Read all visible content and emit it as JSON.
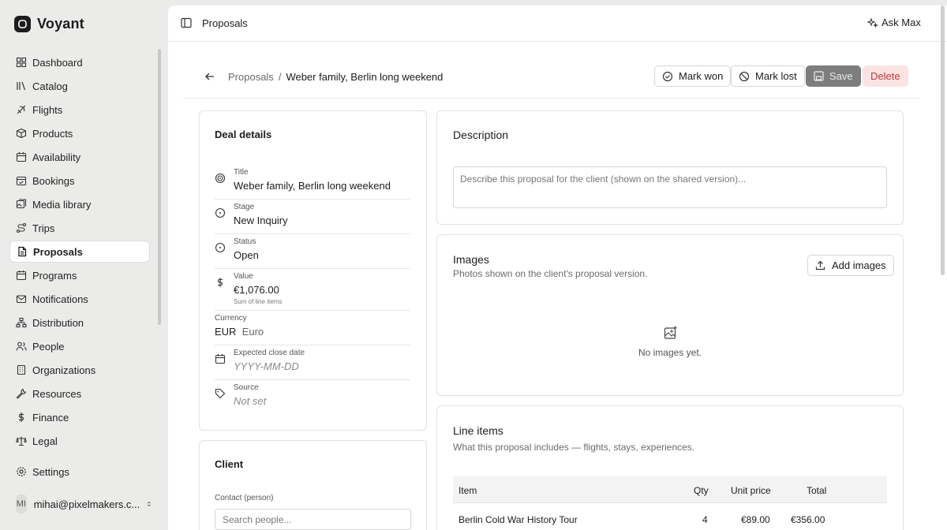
{
  "app": {
    "name": "Voyant"
  },
  "sidebar": {
    "items": [
      {
        "label": "Dashboard",
        "icon": "dashboard-icon"
      },
      {
        "label": "Catalog",
        "icon": "catalog-icon"
      },
      {
        "label": "Flights",
        "icon": "plane-icon"
      },
      {
        "label": "Products",
        "icon": "box-icon"
      },
      {
        "label": "Availability",
        "icon": "calendar-icon"
      },
      {
        "label": "Bookings",
        "icon": "calendar-check-icon"
      },
      {
        "label": "Media library",
        "icon": "image-icon"
      },
      {
        "label": "Trips",
        "icon": "route-icon"
      },
      {
        "label": "Proposals",
        "icon": "file-icon",
        "active": true
      },
      {
        "label": "Programs",
        "icon": "calendar-icon"
      },
      {
        "label": "Notifications",
        "icon": "mail-icon"
      },
      {
        "label": "Distribution",
        "icon": "network-icon"
      },
      {
        "label": "People",
        "icon": "people-icon"
      },
      {
        "label": "Organizations",
        "icon": "building-icon"
      },
      {
        "label": "Resources",
        "icon": "wrench-icon"
      },
      {
        "label": "Finance",
        "icon": "dollar-icon"
      },
      {
        "label": "Legal",
        "icon": "scale-icon"
      }
    ],
    "settings_label": "Settings",
    "user": {
      "initials": "MI",
      "email": "mihai@pixelmakers.c..."
    }
  },
  "topbar": {
    "title": "Proposals",
    "ask_label": "Ask Max"
  },
  "breadcrumb": {
    "parent": "Proposals",
    "separator": "/",
    "current": "Weber family, Berlin long weekend"
  },
  "actions": {
    "mark_won": "Mark won",
    "mark_lost": "Mark lost",
    "save": "Save",
    "delete": "Delete"
  },
  "deal": {
    "title": "Deal details",
    "fields": {
      "title": {
        "label": "Title",
        "value": "Weber family, Berlin long weekend"
      },
      "stage": {
        "label": "Stage",
        "value": "New Inquiry"
      },
      "status": {
        "label": "Status",
        "value": "Open"
      },
      "value": {
        "label": "Value",
        "value": "€1,076.00",
        "hint": "Sum of line items"
      },
      "currency": {
        "label": "Currency",
        "code": "EUR",
        "name": "Euro"
      },
      "close_date": {
        "label": "Expected close date",
        "placeholder": "YYYY-MM-DD"
      },
      "source": {
        "label": "Source",
        "value": "Not set"
      }
    }
  },
  "client": {
    "title": "Client",
    "contact_label": "Contact (person)",
    "contact_placeholder": "Search people..."
  },
  "description": {
    "title": "Description",
    "placeholder": "Describe this proposal for the client (shown on the shared version)..."
  },
  "images": {
    "title": "Images",
    "subtitle": "Photos shown on the client's proposal version.",
    "add_label": "Add images",
    "empty": "No images yet."
  },
  "line_items": {
    "title": "Line items",
    "subtitle": "What this proposal includes — flights, stays, experiences.",
    "columns": {
      "item": "Item",
      "qty": "Qty",
      "unit": "Unit price",
      "total": "Total"
    },
    "rows": [
      {
        "item": "Berlin Cold War History Tour",
        "qty": "4",
        "unit": "€89.00",
        "total": "€356.00"
      }
    ]
  }
}
